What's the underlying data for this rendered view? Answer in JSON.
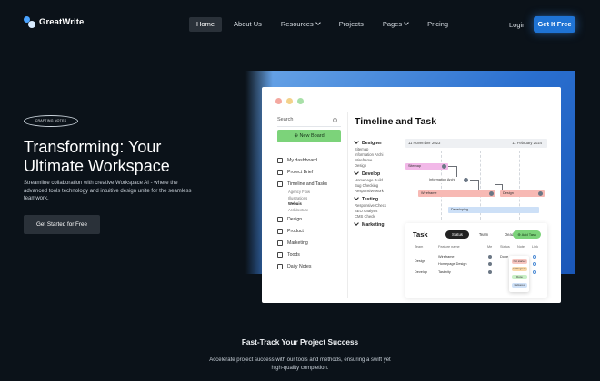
{
  "brand": {
    "name": "GreatWrite"
  },
  "nav": {
    "items": [
      {
        "label": "Home",
        "active": true,
        "dropdown": false
      },
      {
        "label": "About Us",
        "active": false,
        "dropdown": false
      },
      {
        "label": "Resources",
        "active": false,
        "dropdown": true
      },
      {
        "label": "Projects",
        "active": false,
        "dropdown": false
      },
      {
        "label": "Pages",
        "active": false,
        "dropdown": true
      },
      {
        "label": "Pricing",
        "active": false,
        "dropdown": false
      }
    ],
    "login": "Login",
    "cta": "Get It Free"
  },
  "hero": {
    "pill": "CRAFTING NOTES",
    "title": "Transforming: Your Ultimate Workspace",
    "subtitle": "Streamline collaboration with creative Workspace AI - where the advanced tools technology and intuitive design unite for the seamless teamwork.",
    "button": "Get Started for Free"
  },
  "mockup": {
    "search_placeholder": "Search",
    "new_board": "New Board",
    "nav": [
      {
        "label": "My dashboard",
        "icon": "home-icon"
      },
      {
        "label": "Project Brief",
        "icon": "file-icon"
      },
      {
        "label": "Timeline and Tasks",
        "icon": "timeline-icon"
      },
      {
        "label": "Design",
        "icon": "design-icon"
      },
      {
        "label": "Product",
        "icon": "box-icon"
      },
      {
        "label": "Marketing",
        "icon": "marketing-icon"
      },
      {
        "label": "Toods",
        "icon": "tools-icon"
      },
      {
        "label": "Daily Notes",
        "icon": "notes-icon"
      }
    ],
    "sub_items": [
      "Agency Flow",
      "Illustrations",
      "Webuis",
      "Architecture"
    ],
    "selected_sub": "Webuis",
    "title": "Timeline and Task",
    "groups": [
      {
        "name": "Designer",
        "items": [
          "Sitemap",
          "Information Archi",
          "Wireframe",
          "Design"
        ]
      },
      {
        "name": "Develop",
        "items": [
          "Homepage Build",
          "Bug Checking",
          "Responsive work"
        ]
      },
      {
        "name": "Testing",
        "items": [
          "Responsive Check",
          "SEO Analysis",
          "CMS Check"
        ]
      },
      {
        "name": "Marketing",
        "items": []
      }
    ],
    "date_start": "11 November 2023",
    "date_end": "11 February 2024",
    "bars": {
      "sitemap": "Sitemap",
      "info": "Information Archi",
      "wireframe": "Wireframe",
      "design": "Design",
      "developing": "Developing"
    },
    "colors": {
      "sitemap": "#f2b8e8",
      "pink": "#f7b9b4",
      "blue": "#cde0f7",
      "green": "#7cd37a"
    },
    "task": {
      "title": "Task",
      "tabs": [
        "Status",
        "Team",
        "Deadline"
      ],
      "add": "Add Task",
      "columns": [
        "Team",
        "Feature name",
        "Me",
        "Status",
        "Note",
        "Link"
      ],
      "rows": [
        {
          "team": "Design",
          "features": [
            "Wireframe",
            "Homepage Design"
          ],
          "status": "Done"
        },
        {
          "team": "Develop",
          "features": [
            "Tasknity"
          ],
          "status": ""
        }
      ],
      "dropdown": [
        "Not started",
        "In Progress",
        "Done",
        "Delivered"
      ]
    }
  },
  "section": {
    "title": "Fast-Track Your Project Success",
    "subtitle": "Accelerate project success with our tools and methods, ensuring a swift yet high-quality completion."
  }
}
